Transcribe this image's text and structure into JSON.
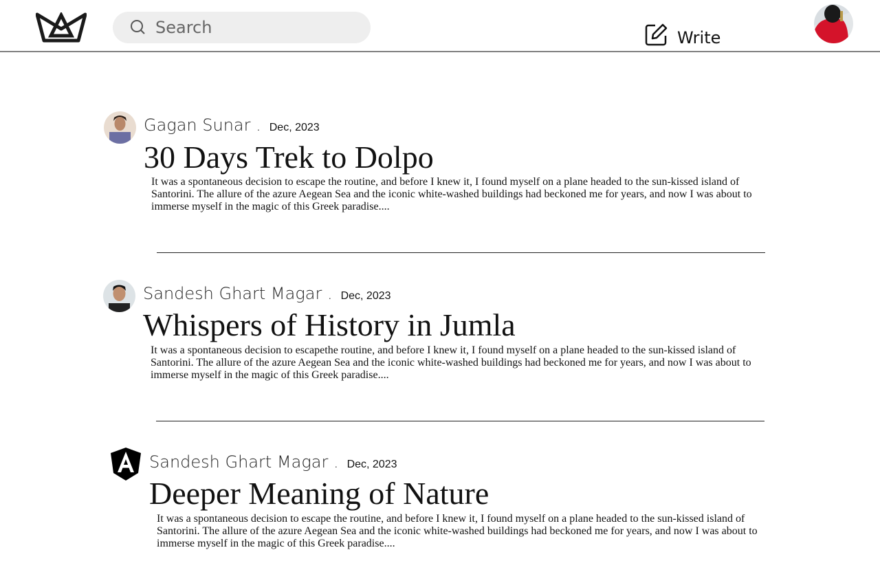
{
  "header": {
    "search_placeholder": "Search",
    "write_label": "Write",
    "logo": "crown-logo",
    "profile_avatar": "user-avatar"
  },
  "posts": [
    {
      "author": "Gagan Sunar .",
      "date": "Dec, 2023",
      "title": "30 Days Trek to Dolpo",
      "excerpt": "It was a spontaneous decision to escape the routine, and before I knew it, I found myself on a plane headed to the sun-kissed island of Santorini. The allure of the azure Aegean Sea and the iconic white-washed buildings had beckoned me for years, and now I was about to immerse myself in the magic of this Greek paradise...."
    },
    {
      "author": "Sandesh Ghart Magar .",
      "date": "Dec, 2023",
      "title": "Whispers of History in Jumla",
      "excerpt": "It was a spontaneous decision to escapethe routine, and before I knew it, I found myself on a plane headed to the sun-kissed island of Santorini. The allure of the azure Aegean Sea and the iconic white-washed buildings had beckoned me for years, and now I was about to immerse myself in the magic of this Greek paradise...."
    },
    {
      "author": "Sandesh Ghart Magar .",
      "date": "Dec, 2023",
      "title": "Deeper Meaning of Nature",
      "excerpt": "It was a spontaneous decision to escape the routine, and before I knew it, I found myself on a plane headed to the sun-kissed island of Santorini. The allure of the azure Aegean Sea and the iconic white-washed buildings had beckoned me for years, and now I was about to immerse myself in the magic of this Greek paradise...."
    }
  ]
}
